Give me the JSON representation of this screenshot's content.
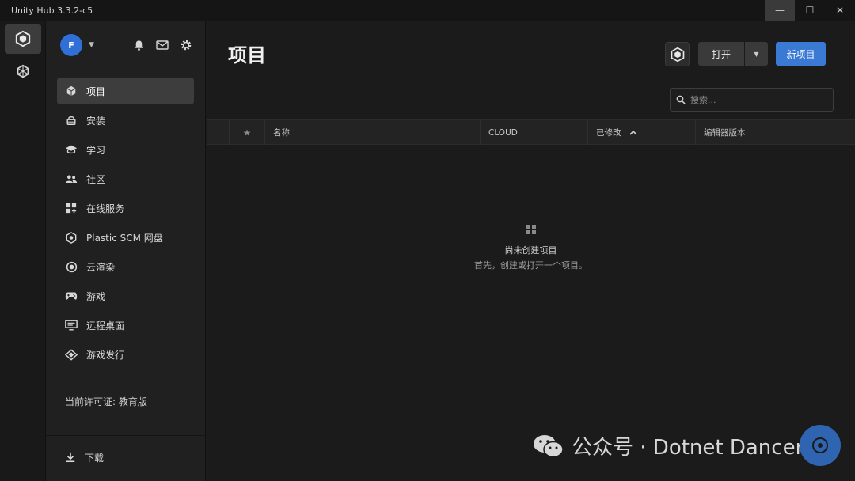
{
  "window": {
    "title": "Unity Hub 3.3.2-c5",
    "controls": [
      "—",
      "☐",
      "✕"
    ]
  },
  "rail": {
    "items": [
      {
        "icon": "unity-cube-icon",
        "active": true
      },
      {
        "icon": "asset-cubes-icon",
        "active": false
      }
    ]
  },
  "sidebar": {
    "avatar_initial": "F",
    "nav": [
      {
        "label": "项目",
        "icon": "cube-icon",
        "active": true
      },
      {
        "label": "安装",
        "icon": "lock-icon",
        "active": false
      },
      {
        "label": "学习",
        "icon": "graduation-cap-icon",
        "active": false
      },
      {
        "label": "社区",
        "icon": "people-icon",
        "active": false
      },
      {
        "label": "在线服务",
        "icon": "services-grid-icon",
        "active": false
      },
      {
        "label": "Plastic SCM 网盘",
        "icon": "plastic-scm-icon",
        "active": false
      },
      {
        "label": "云渲染",
        "icon": "cloud-render-icon",
        "active": false
      },
      {
        "label": "游戏",
        "icon": "gamepad-icon",
        "active": false
      },
      {
        "label": "远程桌面",
        "icon": "remote-desktop-icon",
        "active": false
      },
      {
        "label": "游戏发行",
        "icon": "publish-tag-icon",
        "active": false
      }
    ],
    "license": "当前许可证: 教育版",
    "download": "下载"
  },
  "main": {
    "title": "项目",
    "open_label": "打开",
    "new_label": "新项目",
    "search_placeholder": "搜索...",
    "columns": [
      "名称",
      "CLOUD",
      "已修改",
      "编辑器版本"
    ],
    "empty_title": "尚未创建项目",
    "empty_subtitle": "首先，创建或打开一个项目。"
  },
  "watermark": {
    "text": "公众号 · Dotnet Dancer"
  },
  "colors": {
    "accent": "#3a79d4",
    "avatar": "#2f6fd6",
    "background": "#1b1b1b",
    "sidebar": "#202020"
  }
}
